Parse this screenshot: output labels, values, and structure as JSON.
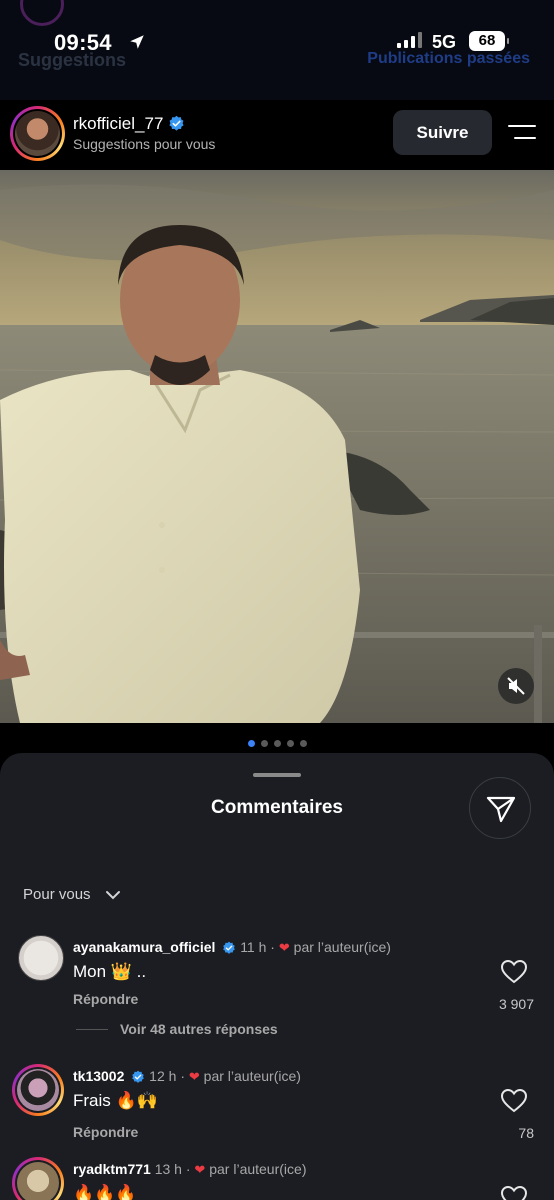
{
  "status_bar": {
    "time": "09:54",
    "network": "5G",
    "battery": "68"
  },
  "background_header": {
    "left_title": "Suggestions",
    "right_title": "Publications passées"
  },
  "post": {
    "username": "rkofficiel_77",
    "subtitle": "Suggestions pour vous",
    "follow_label": "Suivre",
    "carousel_count": 5,
    "carousel_active": 1
  },
  "comments_sheet": {
    "title": "Commentaires",
    "sort_label": "Pour vous",
    "reply_label": "Répondre",
    "comments": [
      {
        "username": "ayanakamura_officiel",
        "verified": true,
        "time": "11 h",
        "author_label": "par l’auteur(ice)",
        "text": "Mon 👑 ..",
        "likes": "3 907",
        "more_replies": "Voir 48 autres réponses"
      },
      {
        "username": "tk13002",
        "verified": true,
        "time": "12 h",
        "author_label": "par l’auteur(ice)",
        "text": "Frais 🔥🙌",
        "likes": "78"
      },
      {
        "username": "ryadktm771",
        "verified": false,
        "time": "13 h",
        "author_label": "par l’auteur(ice)",
        "text": "🔥🔥🔥"
      }
    ]
  },
  "colors": {
    "accent_blue": "#3b82f6",
    "heart_red": "#ed3b44",
    "sheet_bg": "#1b1d22"
  }
}
